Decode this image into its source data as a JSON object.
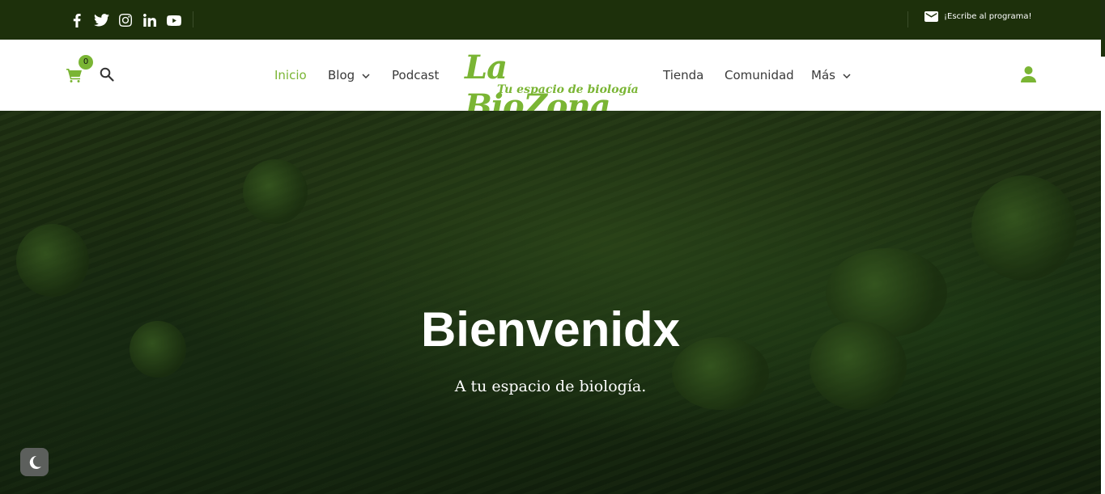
{
  "topbar": {
    "social_icons": [
      "facebook-icon",
      "twitter-icon",
      "instagram-icon",
      "linkedin-icon",
      "youtube-icon"
    ],
    "contact_label": "¡Escribe al programa!",
    "contact_icon": "envelope-icon"
  },
  "header": {
    "cart_count": "0",
    "logo_text": "La BioZona",
    "logo_tagline": "Tu espacio de biología",
    "nav_left": [
      {
        "label": "Inicio",
        "active": true
      },
      {
        "label": "Blog",
        "dropdown": true
      },
      {
        "label": "Podcast"
      }
    ],
    "nav_right": [
      {
        "label": "Tienda"
      },
      {
        "label": "Comunidad"
      },
      {
        "label": "Más",
        "dropdown": true
      }
    ]
  },
  "hero": {
    "title": "Bienvenidx",
    "subtitle": "A tu espacio de biología."
  },
  "colors": {
    "brand_green": "#7ab534",
    "topbar_bg": "#1d300b",
    "header_bg": "#ffffff"
  }
}
